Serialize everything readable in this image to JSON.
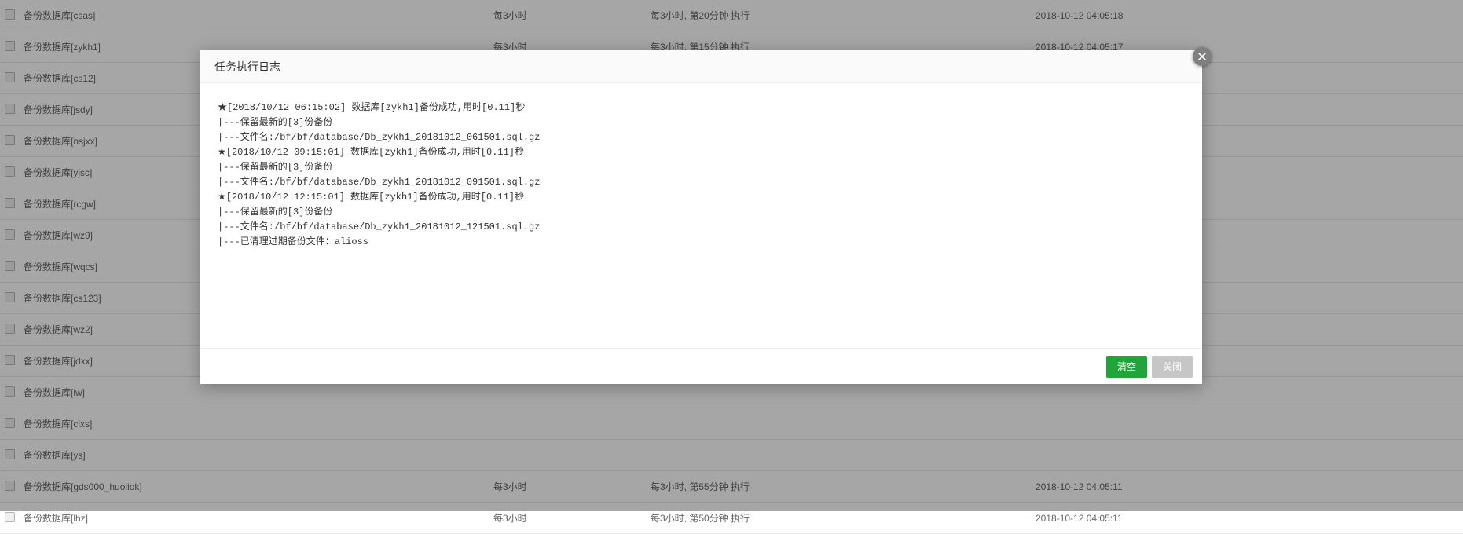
{
  "dialog": {
    "title": "任务执行日志",
    "log_text": "★[2018/10/12 06:15:02] 数据库[zykh1]备份成功,用时[0.11]秒\n|---保留最新的[3]份备份\n|---文件名:/bf/bf/database/Db_zykh1_20181012_061501.sql.gz\n★[2018/10/12 09:15:01] 数据库[zykh1]备份成功,用时[0.11]秒\n|---保留最新的[3]份备份\n|---文件名:/bf/bf/database/Db_zykh1_20181012_091501.sql.gz\n★[2018/10/12 12:15:01] 数据库[zykh1]备份成功,用时[0.11]秒\n|---保留最新的[3]份备份\n|---文件名:/bf/bf/database/Db_zykh1_20181012_121501.sql.gz\n|---已清理过期备份文件：alioss",
    "buttons": {
      "clear": "清空",
      "close": "关闭"
    }
  },
  "table": {
    "rows": [
      {
        "name": "备份数据库[csas]",
        "freq": "每3小时",
        "rule": "每3小时, 第20分钟 执行",
        "time": "2018-10-12 04:05:18"
      },
      {
        "name": "备份数据库[zykh1]",
        "freq": "每3小时",
        "rule": "每3小时, 第15分钟 执行",
        "time": "2018-10-12 04:05:17"
      },
      {
        "name": "备份数据库[cs12]",
        "freq": "",
        "rule": "",
        "time": ""
      },
      {
        "name": "备份数据库[jsdy]",
        "freq": "",
        "rule": "",
        "time": ""
      },
      {
        "name": "备份数据库[nsjxx]",
        "freq": "",
        "rule": "",
        "time": ""
      },
      {
        "name": "备份数据库[yjsc]",
        "freq": "",
        "rule": "",
        "time": ""
      },
      {
        "name": "备份数据库[rcgw]",
        "freq": "",
        "rule": "",
        "time": ""
      },
      {
        "name": "备份数据库[wz9]",
        "freq": "",
        "rule": "",
        "time": ""
      },
      {
        "name": "备份数据库[wqcs]",
        "freq": "",
        "rule": "",
        "time": ""
      },
      {
        "name": "备份数据库[cs123]",
        "freq": "",
        "rule": "",
        "time": ""
      },
      {
        "name": "备份数据库[wz2]",
        "freq": "",
        "rule": "",
        "time": ""
      },
      {
        "name": "备份数据库[jdxx]",
        "freq": "",
        "rule": "",
        "time": ""
      },
      {
        "name": "备份数据库[lw]",
        "freq": "",
        "rule": "",
        "time": ""
      },
      {
        "name": "备份数据库[clxs]",
        "freq": "",
        "rule": "",
        "time": ""
      },
      {
        "name": "备份数据库[ys]",
        "freq": "",
        "rule": "",
        "time": ""
      },
      {
        "name": "备份数据库[gds000_huoliok]",
        "freq": "每3小时",
        "rule": "每3小时, 第55分钟 执行",
        "time": "2018-10-12 04:05:11"
      },
      {
        "name": "备份数据库[lhz]",
        "freq": "每3小时",
        "rule": "每3小时, 第50分钟 执行",
        "time": "2018-10-12 04:05:11"
      }
    ]
  }
}
